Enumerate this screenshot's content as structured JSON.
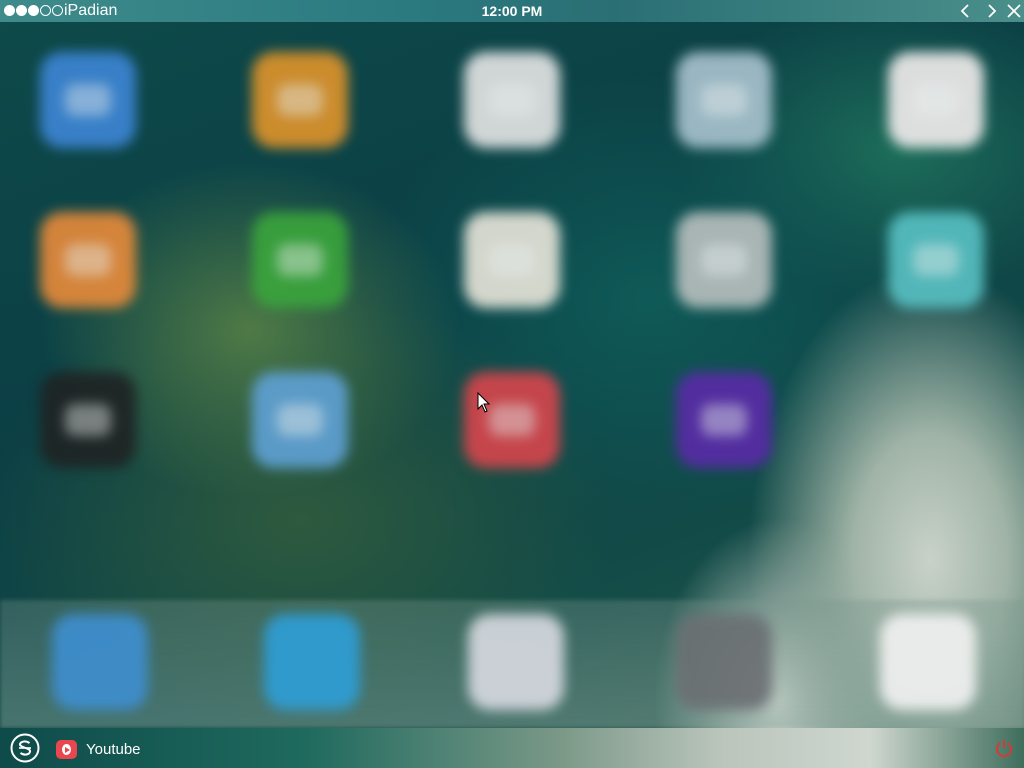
{
  "window": {
    "title": "iPadian",
    "clock": "12:00 PM",
    "signal": {
      "filled": 3,
      "empty": 2
    }
  },
  "controls": {
    "back_icon": "chevron-left-icon",
    "forward_icon": "chevron-right-icon",
    "close_icon": "close-icon"
  },
  "home_screen": {
    "app_icons": [
      {
        "name": "app-blue",
        "color": "#3d86d6"
      },
      {
        "name": "app-orange-grid",
        "color": "#e0942a"
      },
      {
        "name": "app-clock",
        "color": "#e6e6e6"
      },
      {
        "name": "app-light-blue",
        "color": "#a9c3cf"
      },
      {
        "name": "app-heart",
        "color": "#f2eded"
      },
      {
        "name": "app-orange-card",
        "color": "#e98b3a"
      },
      {
        "name": "app-green-message",
        "color": "#3aa53c"
      },
      {
        "name": "app-notes",
        "color": "#e9e6da"
      },
      {
        "name": "app-gray",
        "color": "#b9c0bf"
      },
      {
        "name": "app-teal",
        "color": "#58c1c4"
      },
      {
        "name": "app-dark",
        "color": "#1f2323"
      },
      {
        "name": "app-weather",
        "color": "#5fa1d6"
      },
      {
        "name": "app-red",
        "color": "#d8454c"
      },
      {
        "name": "app-purple",
        "color": "#5a2aa8"
      }
    ],
    "dock_icons": [
      {
        "name": "dock-safari",
        "color": "#3e8fd1"
      },
      {
        "name": "dock-mail",
        "color": "#2e9fd8"
      },
      {
        "name": "dock-music",
        "color": "#d9dbe2"
      },
      {
        "name": "dock-settings",
        "color": "#6b6f72"
      },
      {
        "name": "dock-photos",
        "color": "#f2f2f2"
      }
    ]
  },
  "taskbar": {
    "launcher_icon": "ipadian-logo-icon",
    "running_app": {
      "label": "Youtube",
      "icon": "youtube-icon",
      "color": "#e8474f"
    },
    "power_icon": "power-icon",
    "power_color": "#d33b36"
  }
}
